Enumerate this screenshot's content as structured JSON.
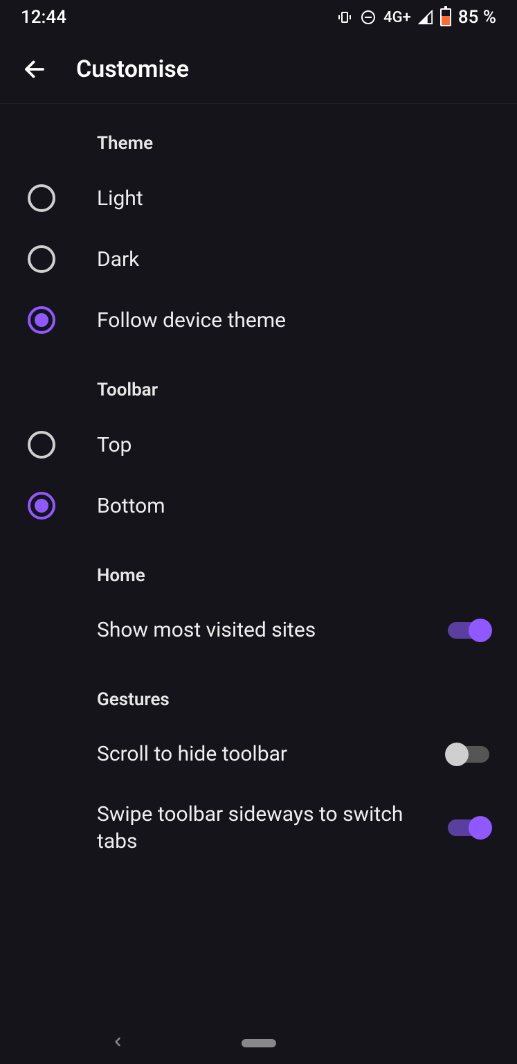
{
  "statusbar": {
    "time": "12:44",
    "network": "4G+",
    "battery": "85 %"
  },
  "header": {
    "title": "Customise"
  },
  "sections": {
    "theme": {
      "title": "Theme",
      "options": {
        "light": "Light",
        "dark": "Dark",
        "follow": "Follow device theme"
      },
      "selected": "follow"
    },
    "toolbar": {
      "title": "Toolbar",
      "options": {
        "top": "Top",
        "bottom": "Bottom"
      },
      "selected": "bottom"
    },
    "home": {
      "title": "Home",
      "showMostVisited": {
        "label": "Show most visited sites",
        "value": true
      }
    },
    "gestures": {
      "title": "Gestures",
      "scrollHide": {
        "label": "Scroll to hide toolbar",
        "value": false
      },
      "swipeSwitch": {
        "label": "Swipe toolbar sideways to switch tabs",
        "value": true
      }
    }
  },
  "colors": {
    "accent": "#9059ff"
  }
}
